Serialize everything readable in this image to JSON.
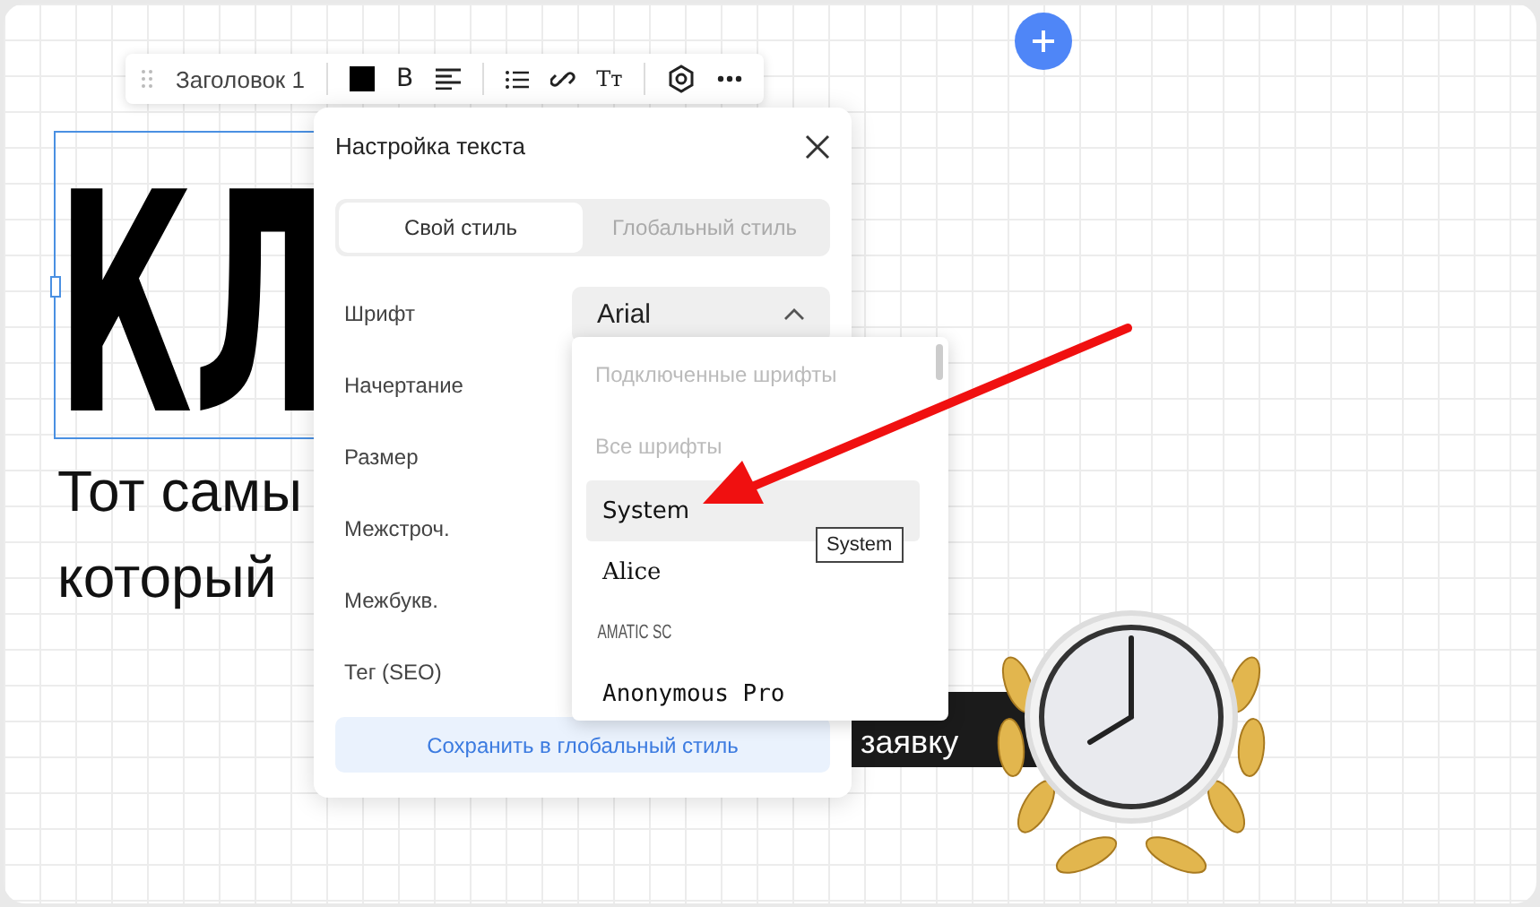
{
  "toolbar": {
    "style_label": "Заголовок 1",
    "bold_label": "B",
    "text_size_label": "Tт"
  },
  "heading": {
    "text": "КЛ"
  },
  "body_text": [
    "Тот самы",
    "который"
  ],
  "cta_button": {
    "label": "заявку"
  },
  "panel": {
    "title": "Настройка текста",
    "tabs": [
      {
        "label": "Свой стиль",
        "selected": true
      },
      {
        "label": "Глобальный стиль",
        "selected": false
      }
    ],
    "rows": [
      {
        "label": "Шрифт",
        "value": "Arial"
      },
      {
        "label": "Начертание"
      },
      {
        "label": "Размер"
      },
      {
        "label": "Межстроч."
      },
      {
        "label": "Межбукв."
      },
      {
        "label": "Тег (SEO)"
      }
    ],
    "save_button": "Сохранить в глобальный стиль"
  },
  "font_menu": {
    "connected_header": "Подключенные шрифты",
    "all_header": "Все шрифты",
    "items": [
      {
        "label": "System",
        "kind": "sans",
        "selected": true
      },
      {
        "label": "Alice",
        "kind": "serif",
        "selected": false
      },
      {
        "label": "AMATIC SC",
        "kind": "display",
        "selected": false
      },
      {
        "label": "Anonymous Pro",
        "kind": "mono",
        "selected": false
      }
    ]
  },
  "tooltip": "System"
}
